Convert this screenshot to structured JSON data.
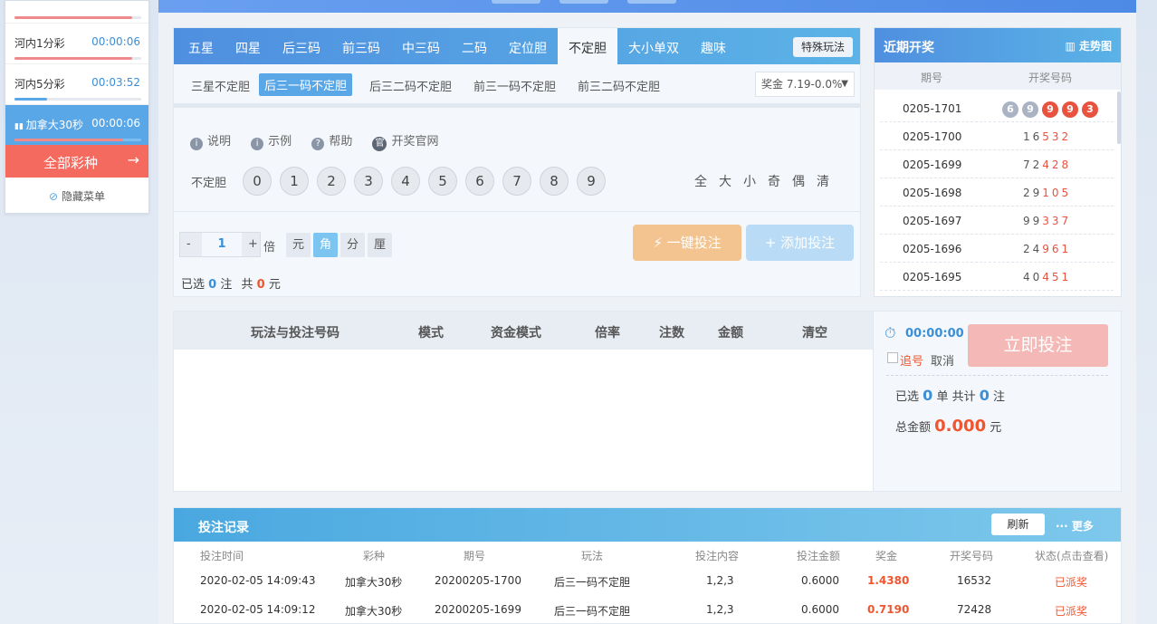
{
  "sidebar": {
    "items": [
      {
        "name": "河内1分彩",
        "time": "00:00:06"
      },
      {
        "name": "河内5分彩",
        "time": "00:03:52"
      },
      {
        "name": "加拿大30秒",
        "time": "00:00:06"
      }
    ],
    "all_lotteries": "全部彩种",
    "hide_menu": "隐藏菜单"
  },
  "tabs": [
    "五星",
    "四星",
    "后三码",
    "前三码",
    "中三码",
    "二码",
    "定位胆",
    "不定胆",
    "大小单双",
    "趣味"
  ],
  "special_play": "特殊玩法",
  "subtabs": [
    "三星不定胆",
    "后三一码不定胆",
    "后三二码不定胆",
    "前三一码不定胆",
    "前三二码不定胆"
  ],
  "prize": "奖金 7.19-0.0%",
  "help_links": [
    {
      "icon": "i",
      "label": "说明"
    },
    {
      "icon": "i",
      "label": "示例"
    },
    {
      "icon": "?",
      "label": "帮助"
    },
    {
      "icon": "官",
      "label": "开奖官网"
    }
  ],
  "balls_label": "不定胆",
  "balls": [
    "0",
    "1",
    "2",
    "3",
    "4",
    "5",
    "6",
    "7",
    "8",
    "9"
  ],
  "quick_select": [
    "全",
    "大",
    "小",
    "奇",
    "偶",
    "清"
  ],
  "multiplier": {
    "minus": "-",
    "value": "1",
    "plus": "+",
    "unit": "倍"
  },
  "money_units": [
    "元",
    "角",
    "分",
    "厘"
  ],
  "one_click_bet": "一键投注",
  "add_bet": "添加投注",
  "selection": {
    "prefix": "已选",
    "count": "0",
    "unit": "注",
    "total_label": "共",
    "amount": "0",
    "currency": "元"
  },
  "recent": {
    "title": "近期开奖",
    "trend": "走势图",
    "col_period": "期号",
    "col_numbers": "开奖号码",
    "rows": [
      {
        "period": "0205-1701",
        "numbers": "69993"
      },
      {
        "period": "0205-1700",
        "numbers": "16532"
      },
      {
        "period": "0205-1699",
        "numbers": "72428"
      },
      {
        "period": "0205-1698",
        "numbers": "29105"
      },
      {
        "period": "0205-1697",
        "numbers": "99337"
      },
      {
        "period": "0205-1696",
        "numbers": "24961"
      },
      {
        "period": "0205-1695",
        "numbers": "40451"
      }
    ]
  },
  "slip": {
    "columns": [
      "玩法与投注号码",
      "模式",
      "资金模式",
      "倍率",
      "注数",
      "金额",
      "清空"
    ]
  },
  "side": {
    "timer": "00:00:00",
    "chase": "追号",
    "cancel": "取消",
    "bet_now": "立即投注",
    "summary_pre": "已选",
    "orders": "0",
    "summary_mid": "单 共计",
    "notes": "0",
    "summary_post": "注",
    "total_label": "总金额",
    "total": "0.000",
    "currency": "元"
  },
  "records": {
    "title": "投注记录",
    "refresh": "刷新",
    "more": "更多",
    "columns": [
      "投注时间",
      "彩种",
      "期号",
      "玩法",
      "投注内容",
      "投注金额",
      "奖金",
      "开奖号码",
      "状态(点击查看)"
    ],
    "rows": [
      [
        "2020-02-05 14:09:43",
        "加拿大30秒",
        "20200205-1700",
        "后三一码不定胆",
        "1,2,3",
        "0.6000",
        "1.4380",
        "16532",
        "已派奖"
      ],
      [
        "2020-02-05 14:09:12",
        "加拿大30秒",
        "20200205-1699",
        "后三一码不定胆",
        "1,2,3",
        "0.6000",
        "0.7190",
        "72428",
        "已派奖"
      ]
    ]
  },
  "colors": {
    "accent": "#5aa7e8",
    "red": "#f0552f",
    "ball_red": "#e8523f",
    "ball_grey": "#a9b3c4"
  }
}
